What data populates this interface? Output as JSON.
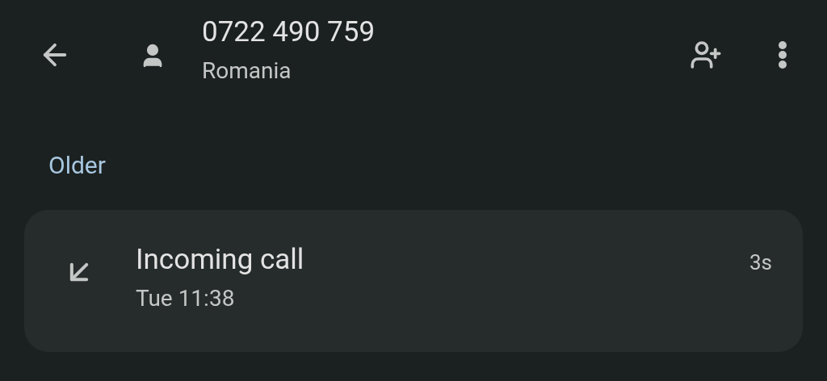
{
  "header": {
    "title": "0722 490 759",
    "subtitle": "Romania"
  },
  "section": {
    "label": "Older"
  },
  "calls": [
    {
      "kind": "incoming",
      "title": "Incoming call",
      "time": "Tue 11:38",
      "duration": "3s"
    }
  ]
}
